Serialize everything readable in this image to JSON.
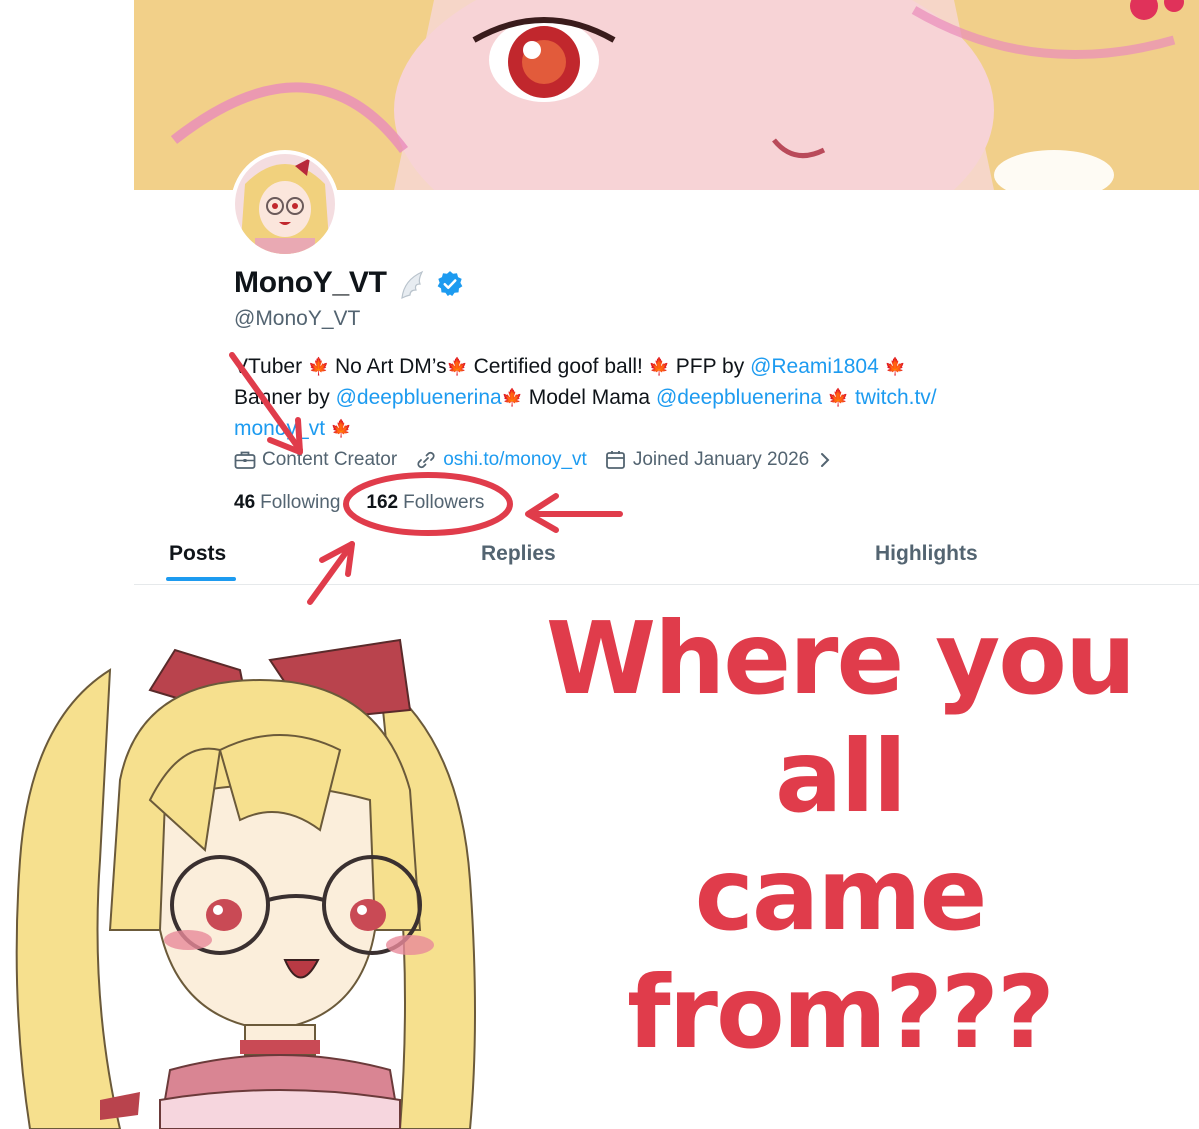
{
  "profile": {
    "display_name": "MonoY_VT",
    "handle": "@MonoY_VT",
    "bio": {
      "line1_a": "VTuber",
      "line1_b": "No Art DM’s",
      "line1_c": "Certified goof ball!",
      "line1_d": "PFP by",
      "line1_link": "@Reami1804",
      "line2_a": "Banner by",
      "line2_link1": "@deepbluenerina",
      "line2_b": "Model Mama",
      "line2_link2": "@deepbluenerina",
      "line2_link3": "twitch.tv/",
      "line3_link": "monoy_vt"
    },
    "meta": {
      "category": "Content Creator",
      "website": "oshi.to/monoy_vt",
      "joined": "Joined January 2026"
    },
    "stats": {
      "following_count": "46",
      "following_label": "Following",
      "followers_count": "162",
      "followers_label": "Followers"
    }
  },
  "tabs": [
    {
      "label": "Posts",
      "active": true
    },
    {
      "label": "Replies",
      "active": false
    },
    {
      "label": "Highlights",
      "active": false
    }
  ],
  "caption": {
    "line1": "Where you all",
    "line2": "came from???"
  },
  "icons": {
    "wing": "wing-icon",
    "verified": "verified-badge-icon",
    "leaf": "maple-leaf-icon",
    "category": "briefcase-icon",
    "website": "link-icon",
    "joined": "calendar-icon",
    "chevron": "chevron-right-icon"
  },
  "colors": {
    "accent": "#1d9bf0",
    "annotation_red": "#e03c4b",
    "secondary_text": "#536471"
  }
}
